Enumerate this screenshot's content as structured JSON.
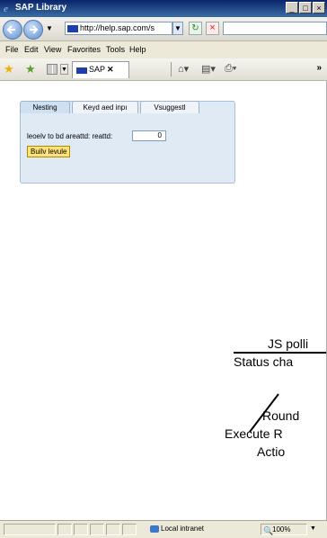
{
  "window": {
    "title": "SAP Library"
  },
  "address": {
    "url": "http://help.sap.com/s"
  },
  "menu": [
    "File",
    "Edit",
    "View",
    "Favorites",
    "Tools",
    "Help"
  ],
  "favorites_bar": {
    "tab_label": "SAP",
    "overflow": "»"
  },
  "panel": {
    "tabs": [
      "Nesting",
      "Keyd aed inpı",
      "Vsuggestl"
    ],
    "field_label": "leoelv to bd areattd:  reattd:",
    "field_value": "0",
    "button_label": "Builv levule"
  },
  "diagram": {
    "lines": [
      "JS polli",
      "Status cha",
      "Round",
      "Execute R",
      "Actio"
    ]
  },
  "statusbar": {
    "zone": "Local intranet",
    "zoom": "100%"
  },
  "icons": {
    "back": "back-arrow-icon",
    "forward": "forward-arrow-icon",
    "refresh": "refresh-icon",
    "stop": "stop-icon",
    "favorites": "star-icon",
    "home": "home-icon"
  }
}
